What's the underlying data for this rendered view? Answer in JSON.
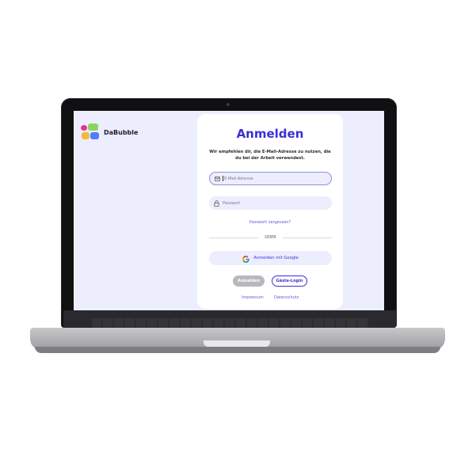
{
  "brand": {
    "name": "DaBubble"
  },
  "login": {
    "title": "Anmelden",
    "subtitle": "Wir empfehlen dir, die E-Mail-Adresse zu nutzen, die du bei der Arbeit verwendest.",
    "email_placeholder": "E-Mail-Adresse",
    "password_placeholder": "Passwort",
    "forgot_password": "Passwort vergessen?",
    "divider": "ODER",
    "google_button": "Anmelden mit Google",
    "login_button": "Anmelden",
    "guest_button": "Gäste-Login"
  },
  "footer": {
    "imprint": "Impressum",
    "privacy": "Datenschutz"
  },
  "colors": {
    "accent": "#3a2fd4",
    "screen_bg": "#eceefe",
    "button_disabled": "#b8b8bc"
  },
  "icons": {
    "email": "mail-icon",
    "password": "lock-icon",
    "google": "google-icon"
  }
}
